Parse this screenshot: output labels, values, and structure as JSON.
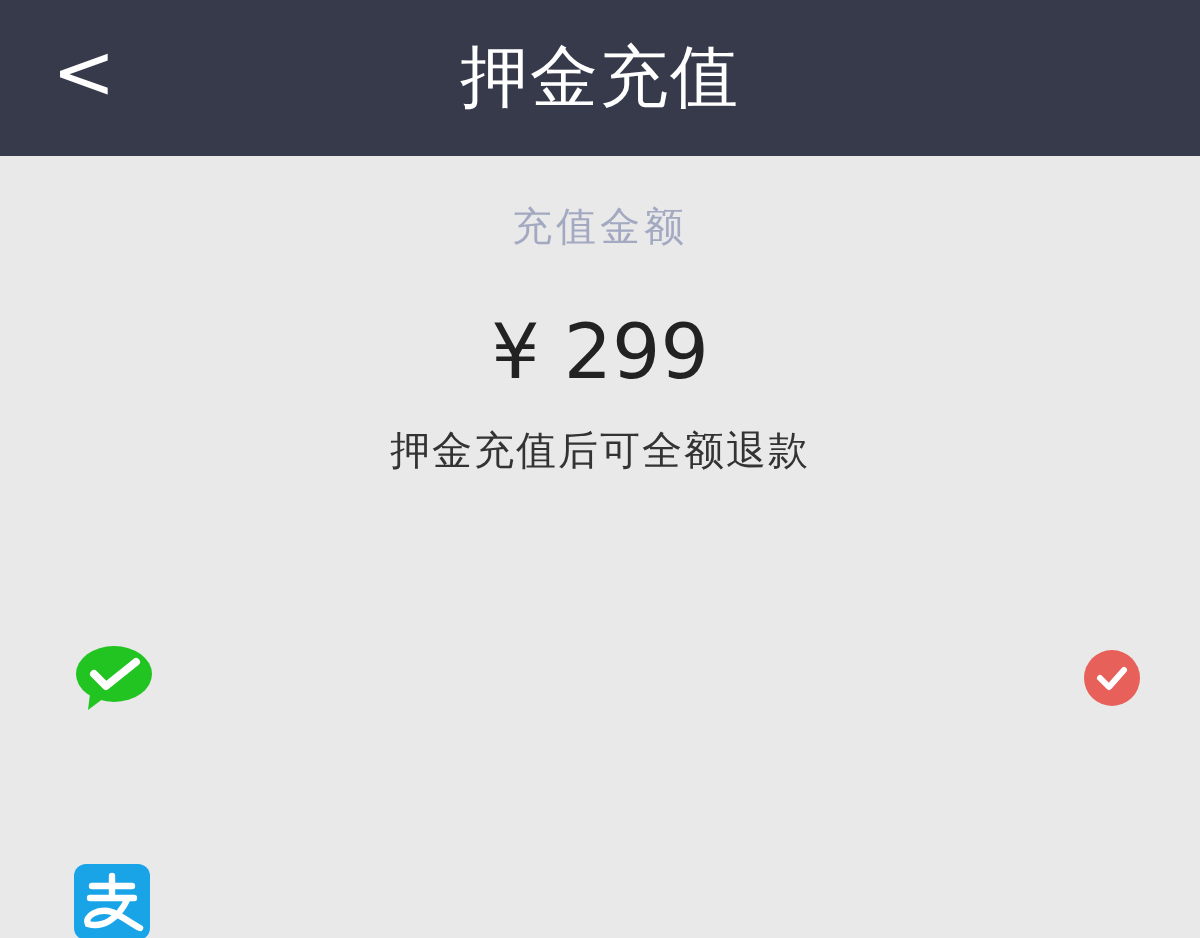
{
  "header": {
    "back": "<",
    "title": "押金充值"
  },
  "amount": {
    "label": "充值金额",
    "value": "¥ 299",
    "note": "押金充值后可全额退款"
  },
  "payment_options": [
    {
      "kind": "wechat",
      "selected": true
    },
    {
      "kind": "alipay",
      "selected": false
    }
  ]
}
